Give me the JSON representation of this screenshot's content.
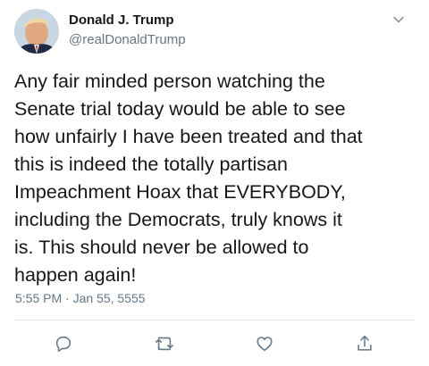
{
  "tweet": {
    "author": {
      "display_name": "Donald J. Trump",
      "handle": "@realDonaldTrump",
      "avatar_icon": "profile-photo"
    },
    "text": "Any fair minded person watching the\nSenate trial today would be able to see\nhow unfairly I have been treated and that\nthis is indeed the totally partisan\nImpeachment Hoax that EVERYBODY,\nincluding the Democrats, truly knows it\nis. This should never be allowed to\nhappen again!",
    "timestamp": "5:55 PM · Jan 55, 5555",
    "menu_icon": "chevron-down-icon",
    "actions": [
      {
        "name": "reply",
        "icon": "reply-icon"
      },
      {
        "name": "retweet",
        "icon": "retweet-icon"
      },
      {
        "name": "like",
        "icon": "heart-icon"
      },
      {
        "name": "share",
        "icon": "share-icon"
      }
    ]
  },
  "colors": {
    "text": "#14171a",
    "secondary": "#657786",
    "divider": "#e1e8ed"
  }
}
